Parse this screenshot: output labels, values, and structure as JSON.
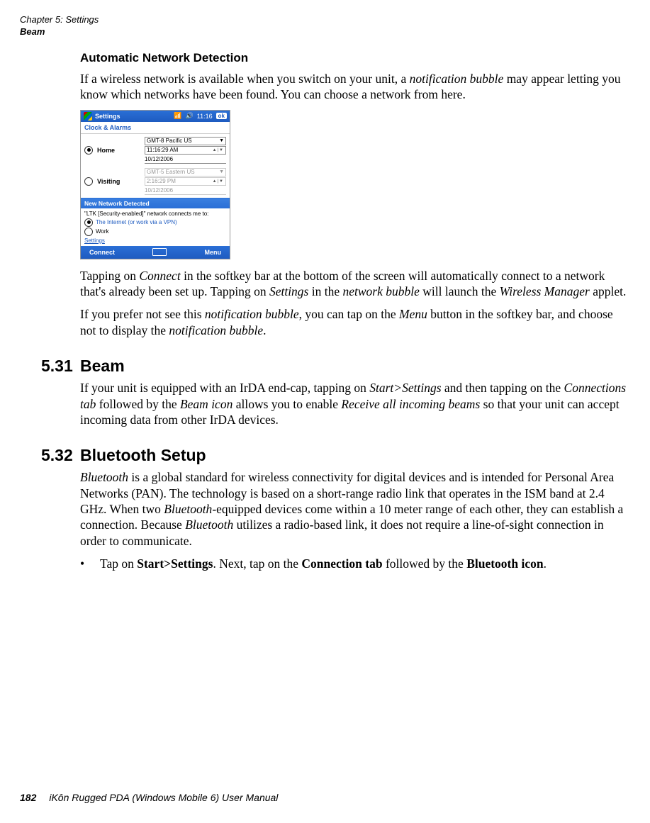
{
  "header": {
    "line1": "Chapter 5: Settings",
    "line2": "Beam"
  },
  "section_auto": {
    "heading": "Automatic Network Detection",
    "para1_a": "If a wireless network is available when you switch on your unit, a ",
    "para1_i1": "notification bubble",
    "para1_b": " may appear letting you know which networks have been found. You can choose a network from here.",
    "para2_a": "Tapping on ",
    "para2_i1": "Connect",
    "para2_b": " in the softkey bar at the bottom of the screen will automatically connect to a network that's already been set up. Tapping on ",
    "para2_i2": "Settings",
    "para2_c": " in the ",
    "para2_i3": "network bubble",
    "para2_d": " will launch the ",
    "para2_i4": "Wireless Manager",
    "para2_e": " applet.",
    "para3_a": "If you prefer not see this ",
    "para3_i1": "notification bubble",
    "para3_b": ", you can tap on the ",
    "para3_i2": "Menu",
    "para3_c": " button in the softkey bar, and choose not to display the ",
    "para3_i3": "notification bubble",
    "para3_d": "."
  },
  "section_beam": {
    "num": "5.31",
    "title": "Beam",
    "para_a": "If your unit is equipped with an IrDA end-cap, tapping on ",
    "para_i1": "Start>Settings",
    "para_b": " and then tapping on the ",
    "para_i2": "Connections tab",
    "para_c": " followed by the ",
    "para_i3": "Beam icon",
    "para_d": " allows you to enable ",
    "para_i4": "Receive all incoming beams",
    "para_e": " so that your unit can accept incoming data from other IrDA devices."
  },
  "section_bt": {
    "num": "5.32",
    "title": "Bluetooth Setup",
    "para_i0": "Bluetooth",
    "para_a": " is a global standard for wireless connectivity for digital devices and is intended for Personal Area Networks (PAN). The technology is based on a short-range radio link that operates in the ISM band at 2.4 GHz. When two ",
    "para_i1": "Bluetooth",
    "para_b": "-equipped devices come within a 10 meter range of each other, they can establish a connection. Because ",
    "para_i2": "Bluetooth",
    "para_c": " utilizes a radio-based link, it does not require a line-of-sight connection in order to communicate.",
    "bullet_a": "Tap on ",
    "bullet_b1": "Start>Settings",
    "bullet_c": ". Next, tap on the ",
    "bullet_b2": "Connection tab",
    "bullet_d": " followed by the ",
    "bullet_b3": "Bluetooth icon",
    "bullet_e": "."
  },
  "footer": {
    "page": "182",
    "book": "iKôn Rugged PDA (Windows Mobile 6) User Manual"
  },
  "device": {
    "title": "Settings",
    "time": "11:16",
    "ok": "ok",
    "sub": "Clock & Alarms",
    "home": "Home",
    "visiting": "Visiting",
    "tz1": "GMT-8 Pacific US",
    "t1": "11:16:29 AM",
    "d1": "10/12/2006",
    "tz2": "GMT-5 Eastern US",
    "t2": "2:16:29 PM",
    "d2": "10/12/2006",
    "popup_title": "New Network Detected",
    "popup_msg": "\"LTK [Security-enabled]\" network connects me to:",
    "opt1": "The Internet (or work via a VPN)",
    "opt2": "Work",
    "settings_link": "Settings",
    "sk_left": "Connect",
    "sk_right": "Menu"
  }
}
